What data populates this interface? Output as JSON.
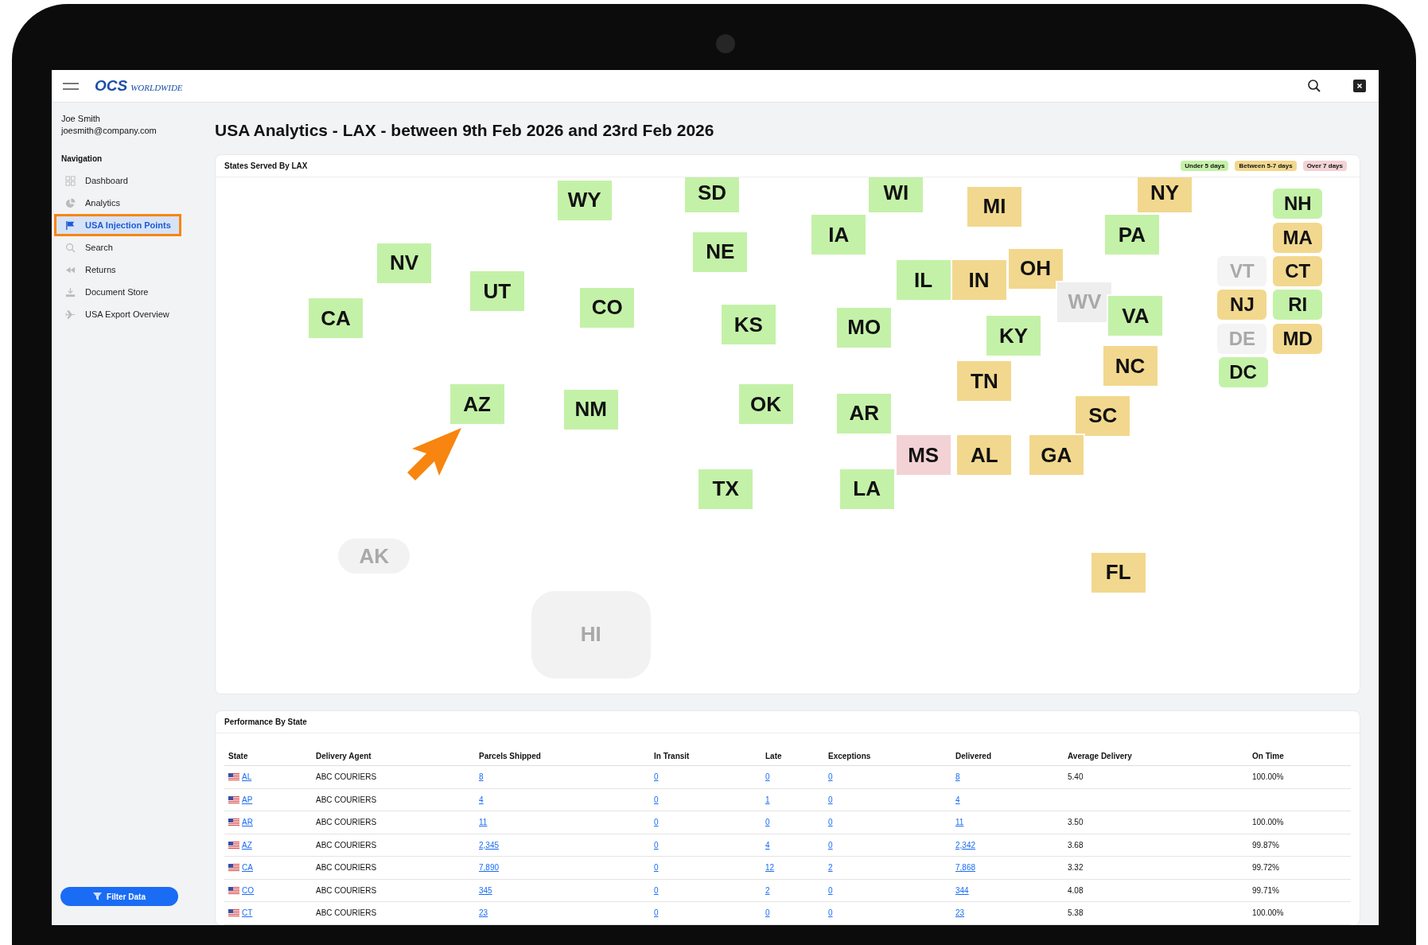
{
  "topbar": {
    "logo_mark": "OCS",
    "logo_text": "WORLDWIDE"
  },
  "user": {
    "name": "Joe Smith",
    "email": "joesmith@company.com"
  },
  "navigation": {
    "heading": "Navigation",
    "items": [
      {
        "label": "Dashboard",
        "selected": false
      },
      {
        "label": "Analytics",
        "selected": false
      },
      {
        "label": "USA Injection Points",
        "selected": true
      },
      {
        "label": "Search",
        "selected": false
      },
      {
        "label": "Returns",
        "selected": false
      },
      {
        "label": "Document Store",
        "selected": false
      },
      {
        "label": "USA Export Overview",
        "selected": false
      }
    ]
  },
  "filter_button": "Filter Data",
  "title": "USA Analytics - LAX - between 9th Feb 2026 and 23rd Feb 2026",
  "map_card": {
    "title": "States Served By LAX",
    "legend": [
      {
        "label": "Under 5 days",
        "color": "#c4f1a8"
      },
      {
        "label": "Between 5-7 days",
        "color": "#f2d88e"
      },
      {
        "label": "Over 7 days",
        "color": "#f3d2d5"
      }
    ],
    "states": [
      {
        "label": "WY",
        "kind": "state",
        "served": true,
        "color": "#c4f1a8"
      },
      {
        "label": "SD",
        "kind": "state",
        "served": true,
        "color": "#c4f1a8"
      },
      {
        "label": "WI",
        "kind": "state",
        "served": true,
        "color": "#c4f1a8"
      },
      {
        "label": "MI",
        "kind": "state",
        "served": true,
        "color": "#f2d88e"
      },
      {
        "label": "NY",
        "kind": "state",
        "served": true,
        "color": "#f2d88e"
      },
      {
        "label": "NV",
        "kind": "state",
        "served": true,
        "color": "#c4f1a8"
      },
      {
        "label": "UT",
        "kind": "state",
        "served": true,
        "color": "#c4f1a8"
      },
      {
        "label": "NE",
        "kind": "state",
        "served": true,
        "color": "#c4f1a8"
      },
      {
        "label": "IA",
        "kind": "state",
        "served": true,
        "color": "#c4f1a8"
      },
      {
        "label": "IL",
        "kind": "state",
        "served": true,
        "color": "#c4f1a8"
      },
      {
        "label": "IN",
        "kind": "state",
        "served": true,
        "color": "#f2d88e"
      },
      {
        "label": "OH",
        "kind": "state",
        "served": true,
        "color": "#f2d88e"
      },
      {
        "label": "PA",
        "kind": "state",
        "served": true,
        "color": "#c4f1a8"
      },
      {
        "label": "CA",
        "kind": "state",
        "served": true,
        "color": "#c4f1a8"
      },
      {
        "label": "CO",
        "kind": "state",
        "served": true,
        "color": "#c4f1a8"
      },
      {
        "label": "KS",
        "kind": "state",
        "served": true,
        "color": "#c4f1a8"
      },
      {
        "label": "MO",
        "kind": "state",
        "served": true,
        "color": "#c4f1a8"
      },
      {
        "label": "KY",
        "kind": "state",
        "served": true,
        "color": "#c4f1a8"
      },
      {
        "label": "WV",
        "kind": "state",
        "served": false,
        "color": "#eeeeee"
      },
      {
        "label": "VA",
        "kind": "state",
        "served": true,
        "color": "#c4f1a8"
      },
      {
        "label": "AZ",
        "kind": "state",
        "served": true,
        "color": "#c4f1a8"
      },
      {
        "label": "NM",
        "kind": "state",
        "served": true,
        "color": "#c4f1a8"
      },
      {
        "label": "OK",
        "kind": "state",
        "served": true,
        "color": "#c4f1a8"
      },
      {
        "label": "AR",
        "kind": "state",
        "served": true,
        "color": "#c4f1a8"
      },
      {
        "label": "TN",
        "kind": "state",
        "served": true,
        "color": "#f2d88e"
      },
      {
        "label": "NC",
        "kind": "state",
        "served": true,
        "color": "#f2d88e"
      },
      {
        "label": "SC",
        "kind": "state",
        "served": true,
        "color": "#f2d88e"
      },
      {
        "label": "MS",
        "kind": "state",
        "served": true,
        "color": "#f3d2d5"
      },
      {
        "label": "AL",
        "kind": "state",
        "served": true,
        "color": "#f2d88e"
      },
      {
        "label": "GA",
        "kind": "state",
        "served": true,
        "color": "#f2d88e"
      },
      {
        "label": "TX",
        "kind": "state",
        "served": true,
        "color": "#c4f1a8"
      },
      {
        "label": "LA",
        "kind": "state",
        "served": true,
        "color": "#c4f1a8"
      },
      {
        "label": "FL",
        "kind": "state",
        "served": true,
        "color": "#f2d88e"
      },
      {
        "label": "AK",
        "kind": "outlying",
        "served": false,
        "color": "#f2f2f2"
      },
      {
        "label": "HI",
        "kind": "outlying",
        "served": false,
        "color": "#f2f2f2"
      },
      {
        "label": "NH",
        "kind": "inset",
        "served": true,
        "color": "#c4f1a8"
      },
      {
        "label": "MA",
        "kind": "inset",
        "served": true,
        "color": "#f2d88e"
      },
      {
        "label": "VT",
        "kind": "inset",
        "served": false,
        "color": "#f4f4f4"
      },
      {
        "label": "CT",
        "kind": "inset",
        "served": true,
        "color": "#f2d88e"
      },
      {
        "label": "NJ",
        "kind": "inset",
        "served": true,
        "color": "#f2d88e"
      },
      {
        "label": "RI",
        "kind": "inset",
        "served": true,
        "color": "#c4f1a8"
      },
      {
        "label": "DE",
        "kind": "inset",
        "served": false,
        "color": "#f4f4f4"
      },
      {
        "label": "MD",
        "kind": "inset",
        "served": true,
        "color": "#f2d88e"
      },
      {
        "label": "DC",
        "kind": "inset",
        "served": true,
        "color": "#c4f1a8"
      }
    ]
  },
  "table_card": {
    "title": "Performance By State",
    "columns": [
      "State",
      "Delivery Agent",
      "Parcels Shipped",
      "In Transit",
      "Late",
      "Exceptions",
      "Delivered",
      "Average Delivery",
      "On Time"
    ],
    "rows": [
      {
        "state": "AL",
        "agent": "ABC COURIERS",
        "parcels": "8",
        "transit": "0",
        "late": "0",
        "exceptions": "0",
        "delivered": "8",
        "average": "5.40",
        "on_time": "100.00%"
      },
      {
        "state": "AP",
        "agent": "ABC COURIERS",
        "parcels": "4",
        "transit": "0",
        "late": "1",
        "exceptions": "0",
        "delivered": "4"
      },
      {
        "state": "AR",
        "agent": "ABC COURIERS",
        "parcels": "11",
        "transit": "0",
        "late": "0",
        "exceptions": "0",
        "delivered": "11",
        "average": "3.50",
        "on_time": "100.00%"
      },
      {
        "state": "AZ",
        "agent": "ABC COURIERS",
        "parcels": "2,345",
        "transit": "0",
        "late": "4",
        "exceptions": "0",
        "delivered": "2,342",
        "average": "3.68",
        "on_time": "99.87%"
      },
      {
        "state": "CA",
        "agent": "ABC COURIERS",
        "parcels": "7,890",
        "transit": "0",
        "late": "12",
        "exceptions": "2",
        "delivered": "7,868",
        "average": "3.32",
        "on_time": "99.72%"
      },
      {
        "state": "CO",
        "agent": "ABC COURIERS",
        "parcels": "345",
        "transit": "0",
        "late": "2",
        "exceptions": "0",
        "delivered": "344",
        "average": "4.08",
        "on_time": "99.71%"
      },
      {
        "state": "CT",
        "agent": "ABC COURIERS",
        "parcels": "23",
        "transit": "0",
        "late": "0",
        "exceptions": "0",
        "delivered": "23",
        "average": "5.38",
        "on_time": "100.00%"
      }
    ]
  }
}
